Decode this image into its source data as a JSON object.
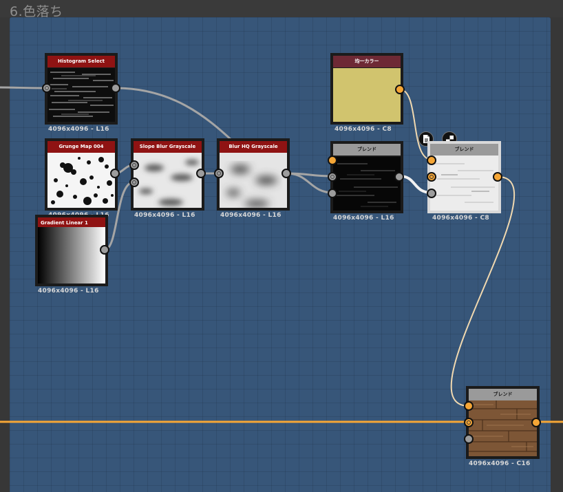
{
  "frame": {
    "title": "6.色落ち"
  },
  "nodes": {
    "histogram_select": {
      "title": "Histogram Select",
      "res": "4096x4096 - L16"
    },
    "grunge_map": {
      "title": "Grunge Map 004",
      "res": "4096x4096 - L16"
    },
    "gradient_linear": {
      "title": "Gradient Linear 1",
      "res": "4096x4096 - L16"
    },
    "slope_blur": {
      "title": "Slope Blur Grayscale",
      "res": "4096x4096 - L16"
    },
    "blur_hq": {
      "title": "Blur HQ Grayscale",
      "res": "4096x4096 - L16"
    },
    "uniform_color": {
      "title": "均一カラー",
      "res": "4096x4096 - C8",
      "swatch": "#d1c46e"
    },
    "blend1": {
      "title": "ブレンド",
      "res": "4096x4096 - L16"
    },
    "blend2": {
      "title": "ブレンド",
      "res": "4096x4096 - C8"
    },
    "blend3": {
      "title": "ブレンド",
      "res": "4096x4096 - C16"
    }
  },
  "icons": {
    "node_tools": [
      "document-icon",
      "checker-icon"
    ]
  },
  "colors": {
    "frame": "#375679",
    "accent_orange": "#f5a636",
    "link_gray": "#a5a5a5",
    "title_red": "#8f1313"
  }
}
